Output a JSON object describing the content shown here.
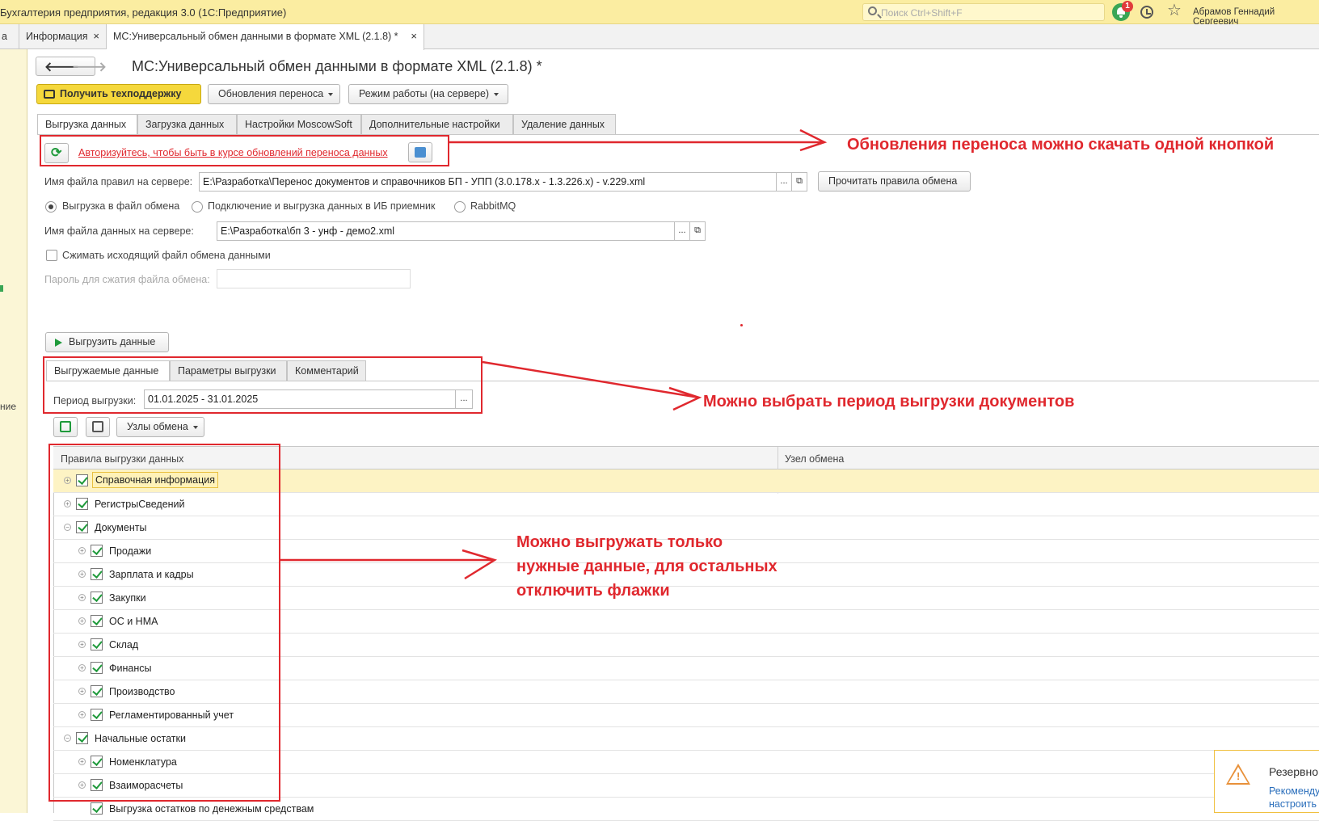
{
  "titlebar": {
    "title": "Бухгалтерия предприятия, редакция 3.0  (1С:Предприятие)",
    "search_placeholder": "Поиск Ctrl+Shift+F",
    "notifications_count": "1",
    "user": "Абрамов Геннадий Сергеевич"
  },
  "open_tabs": [
    {
      "label": "а"
    },
    {
      "label": "Информация",
      "close": "×"
    },
    {
      "label": "МС:Универсальный обмен данными в формате XML (2.1.8) *",
      "close": "×"
    }
  ],
  "left_panel": {
    "label": "ние"
  },
  "nav": {
    "back": "🡐",
    "forward": "🡒"
  },
  "page": {
    "title": "МС:Универсальный обмен данными в формате XML (2.1.8) *"
  },
  "toolbar": {
    "support": "Получить техподдержку",
    "updates": "Обновления переноса",
    "mode": "Режим работы (на сервере)"
  },
  "form_tabs": [
    "Выгрузка данных",
    "Загрузка данных",
    "Настройки MoscowSoft",
    "Дополнительные настройки",
    "Удаление данных"
  ],
  "auth_link": "Авторизуйтесь, чтобы быть в курсе обновлений переноса данных",
  "rules": {
    "label": "Имя файла правил на сервере:",
    "value": "E:\\Разработка\\Перенос документов и справочников БП - УПП (3.0.178.x - 1.3.226.x) - v.229.xml",
    "read_button": "Прочитать правила обмена"
  },
  "export_mode": {
    "options": [
      "Выгрузка в файл обмена",
      "Подключение и выгрузка данных в ИБ приемник",
      "RabbitMQ"
    ],
    "selected": "Выгрузка в файл обмена"
  },
  "datafile": {
    "label": "Имя файла данных на сервере:",
    "value": "E:\\Разработка\\бп 3 - унф - демо2.xml"
  },
  "compress": {
    "label": "Сжимать исходящий файл обмена данными",
    "checked": false
  },
  "password": {
    "label": "Пароль для сжатия файла обмена:",
    "value": ""
  },
  "export_button": "Выгрузить данные",
  "inner_tabs": [
    "Выгружаемые данные",
    "Параметры выгрузки",
    "Комментарий"
  ],
  "period": {
    "label": "Период выгрузки:",
    "value": "01.01.2025 - 31.01.2025"
  },
  "nodes_button": "Узлы обмена",
  "tree": {
    "columns": [
      "Правила выгрузки данных",
      "Узел обмена"
    ],
    "rows": [
      {
        "label": "Справочная информация",
        "level": 0,
        "expander": "+",
        "checked": true
      },
      {
        "label": "РегистрыСведений",
        "level": 0,
        "expander": "+",
        "checked": true
      },
      {
        "label": "Документы",
        "level": 0,
        "expander": "−",
        "checked": true
      },
      {
        "label": "Продажи",
        "level": 1,
        "expander": "+",
        "checked": true
      },
      {
        "label": "Зарплата и кадры",
        "level": 1,
        "expander": "+",
        "checked": true
      },
      {
        "label": "Закупки",
        "level": 1,
        "expander": "+",
        "checked": true
      },
      {
        "label": "ОС и НМА",
        "level": 1,
        "expander": "+",
        "checked": true
      },
      {
        "label": "Склад",
        "level": 1,
        "expander": "+",
        "checked": true
      },
      {
        "label": "Финансы",
        "level": 1,
        "expander": "+",
        "checked": true
      },
      {
        "label": "Производство",
        "level": 1,
        "expander": "+",
        "checked": true
      },
      {
        "label": "Регламентированный учет",
        "level": 1,
        "expander": "+",
        "checked": true
      },
      {
        "label": "Начальные остатки",
        "level": 0,
        "expander": "−",
        "checked": true
      },
      {
        "label": "Номенклатура",
        "level": 1,
        "expander": "+",
        "checked": true
      },
      {
        "label": "Взаиморасчеты",
        "level": 1,
        "expander": "+",
        "checked": true
      },
      {
        "label": "Выгрузка остатков по денежным средствам",
        "level": 1,
        "expander": "",
        "checked": true
      }
    ]
  },
  "annotations": [
    "Обновления переноса можно скачать одной кнопкой",
    "Можно выбрать период выгрузки документов",
    "Можно выгружать только",
    "нужные данные, для остальных",
    "отключить флажки"
  ],
  "notice": {
    "title": "Резервно",
    "text1": "Рекоменду",
    "text2": "настроить"
  }
}
